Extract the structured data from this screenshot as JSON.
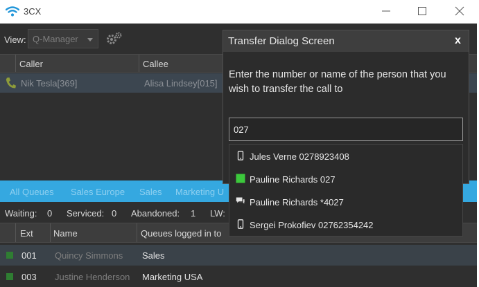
{
  "window": {
    "title": "3CX"
  },
  "toolbar": {
    "view_label": "View:",
    "view_value": "Q-Manager"
  },
  "calls": {
    "headers": {
      "caller": "Caller",
      "callee": "Callee"
    },
    "rows": [
      {
        "caller": "Nik Tesla[369]",
        "callee": "Alisa Lindsey[015]"
      }
    ]
  },
  "queue_tabs": [
    "All Queues",
    "Sales Europe",
    "Sales",
    "Marketing U"
  ],
  "stats": {
    "waiting_label": "Waiting:",
    "waiting": "0",
    "serviced_label": "Serviced:",
    "serviced": "0",
    "abandoned_label": "Abandoned:",
    "abandoned": "1",
    "lw_label": "LW:"
  },
  "agents": {
    "headers": {
      "ext": "Ext",
      "name": "Name",
      "queues": "Queues logged in to"
    },
    "rows": [
      {
        "ext": "001",
        "name": "Quincy Simmons",
        "queue": "Sales",
        "status_color": "#2f7d32"
      },
      {
        "ext": "003",
        "name": "Justine Henderson",
        "queue": "Marketing USA",
        "status_color": "#2f7d32"
      }
    ]
  },
  "dialog": {
    "title": "Transfer Dialog Screen",
    "close_label": "x",
    "instructions": "Enter the number or name of the person that you wish to transfer the call to",
    "input_value": "027",
    "suggestions": [
      {
        "label": "Jules Verne 0278923408",
        "icon": "mobile-phone-icon"
      },
      {
        "label": "Pauline Richards 027",
        "icon": "presence-available-icon"
      },
      {
        "label": "Pauline Richards *4027",
        "icon": "chat-icon"
      },
      {
        "label": "Sergei Prokofiev 02762354242",
        "icon": "mobile-phone-icon"
      }
    ]
  },
  "colors": {
    "accent": "#35a8e0",
    "available": "#3cc83c",
    "background": "#2f2f2f"
  }
}
